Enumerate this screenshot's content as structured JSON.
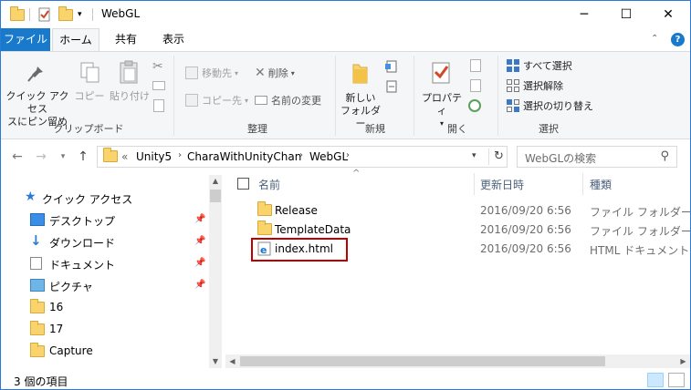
{
  "window": {
    "title": "WebGL",
    "minimize": "─",
    "maximize": "☐",
    "close": "✕"
  },
  "ribbon_tabs": {
    "file": "ファイル",
    "home": "ホーム",
    "share": "共有",
    "view": "表示"
  },
  "ribbon": {
    "clipboard": {
      "quick_access": "クイック アクセス",
      "quick_access2": "スにピン留め",
      "copy": "コピー",
      "paste": "貼り付け",
      "group": "クリップボード"
    },
    "organize": {
      "move_to": "移動先",
      "copy_to": "コピー先",
      "delete": "削除",
      "rename": "名前の変更",
      "group": "整理"
    },
    "new": {
      "new_folder1": "新しい",
      "new_folder2": "フォルダー",
      "group": "新規"
    },
    "open": {
      "properties": "プロパティ",
      "group": "開く"
    },
    "select": {
      "select_all": "すべて選択",
      "select_none": "選択解除",
      "invert": "選択の切り替え",
      "group": "選択"
    },
    "help": "?"
  },
  "address": {
    "overflow": "«",
    "crumbs": [
      "Unity5",
      "CharaWithUnityChan",
      "WebGL"
    ],
    "search_placeholder": "WebGLの検索"
  },
  "nav": {
    "quick_access": "クイック アクセス",
    "items": [
      {
        "label": "デスクトップ",
        "pinned": true
      },
      {
        "label": "ダウンロード",
        "pinned": true
      },
      {
        "label": "ドキュメント",
        "pinned": true
      },
      {
        "label": "ピクチャ",
        "pinned": true
      },
      {
        "label": "16",
        "pinned": false
      },
      {
        "label": "17",
        "pinned": false
      },
      {
        "label": "Capture",
        "pinned": false
      }
    ]
  },
  "columns": {
    "name": "名前",
    "date": "更新日時",
    "type": "種類"
  },
  "files": [
    {
      "name": "Release",
      "date": "2016/09/20 6:56",
      "type": "ファイル フォルダー",
      "kind": "folder"
    },
    {
      "name": "TemplateData",
      "date": "2016/09/20 6:56",
      "type": "ファイル フォルダー",
      "kind": "folder"
    },
    {
      "name": "index.html",
      "date": "2016/09/20 6:56",
      "type": "HTML ドキュメント",
      "kind": "html"
    }
  ],
  "status": {
    "count": "3 個の項目"
  }
}
